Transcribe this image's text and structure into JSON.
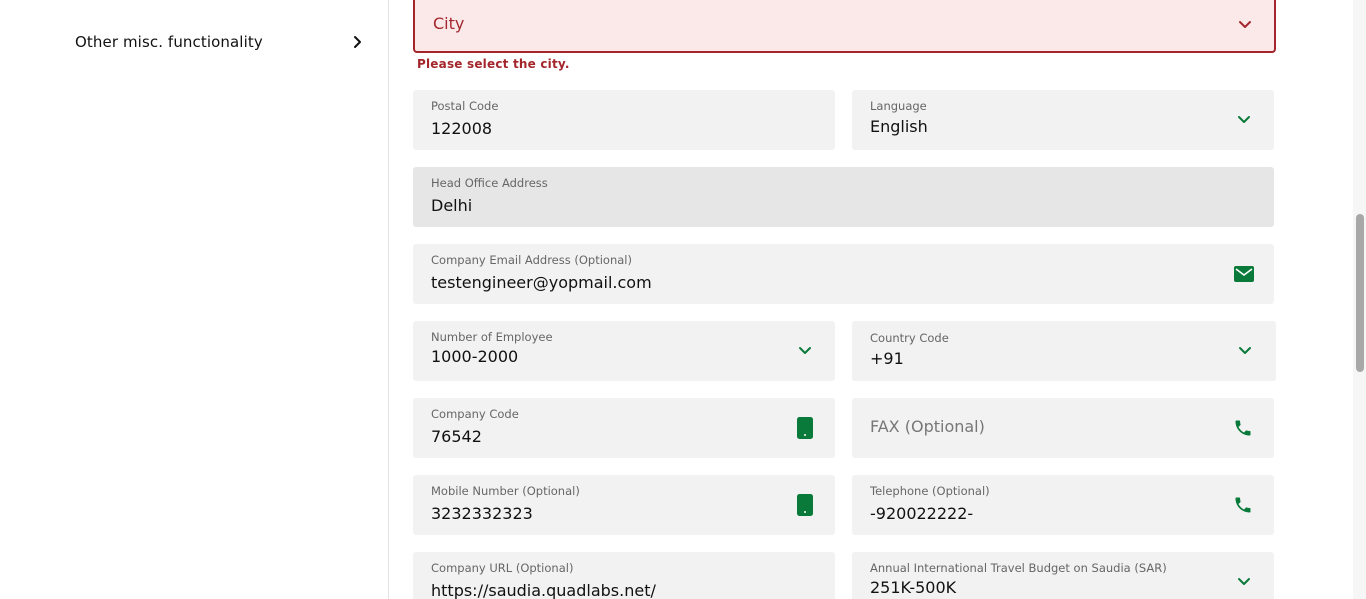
{
  "sidebar": {
    "items": [
      {
        "label": "Other misc. functionality"
      }
    ]
  },
  "form": {
    "city": {
      "value": "City",
      "error": "Please select the city."
    },
    "postal_code": {
      "label": "Postal Code",
      "value": "122008"
    },
    "language": {
      "label": "Language",
      "value": "English"
    },
    "head_office_address": {
      "label": "Head Office Address",
      "value": "Delhi"
    },
    "company_email": {
      "label": "Company Email Address (Optional)",
      "value": "testengineer@yopmail.com"
    },
    "number_of_employee": {
      "label": "Number of Employee",
      "value": "1000-2000"
    },
    "country_code": {
      "label": "Country Code",
      "value": "+91"
    },
    "company_code": {
      "label": "Company Code",
      "value": "76542"
    },
    "fax": {
      "placeholder": "FAX (Optional)"
    },
    "mobile_number": {
      "label": "Mobile Number (Optional)",
      "value": "3232332323"
    },
    "telephone": {
      "label": "Telephone (Optional)",
      "value": "-920022222-"
    },
    "company_url": {
      "label": "Company URL (Optional)",
      "value": "https://saudia.quadlabs.net/"
    },
    "travel_budget": {
      "label": "Annual International Travel Budget on Saudia (SAR)",
      "value": "251K-500K"
    }
  },
  "colors": {
    "accent_green": "#0a7a3a",
    "error_red": "#a4262c",
    "field_bg": "#f2f2f2"
  },
  "icons": {
    "chevron": "chevron-down-icon",
    "email": "envelope-icon",
    "mobile": "mobile-phone-icon",
    "phone": "phone-icon",
    "sidebar_arrow": "chevron-right-icon"
  }
}
